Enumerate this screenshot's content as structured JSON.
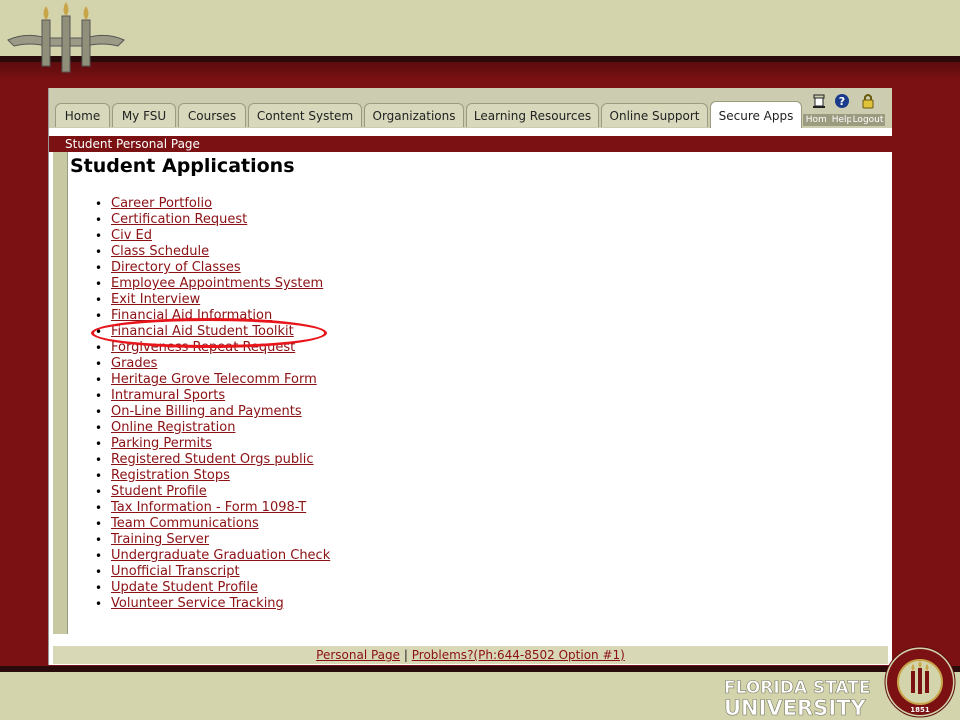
{
  "tabs": [
    {
      "label": "Home",
      "active": false
    },
    {
      "label": "My FSU",
      "active": false
    },
    {
      "label": "Courses",
      "active": false
    },
    {
      "label": "Content System",
      "active": false
    },
    {
      "label": "Organizations",
      "active": false
    },
    {
      "label": "Learning Resources",
      "active": false
    },
    {
      "label": "Online Support",
      "active": false
    },
    {
      "label": "Secure Apps",
      "active": true
    }
  ],
  "utility": {
    "home": "Home",
    "help": "Help",
    "logout": "Logout"
  },
  "subheader": "Student Personal Page",
  "page_title": "Student Applications",
  "apps": [
    "Career Portfolio",
    "Certification Request",
    "Civ Ed",
    "Class Schedule",
    "Directory of Classes",
    "Employee Appointments System",
    "Exit Interview",
    "Financial Aid Information",
    "Financial Aid Student Toolkit",
    "Forgiveness Repeat Request",
    "Grades",
    "Heritage Grove Telecomm Form",
    "Intramural Sports",
    "On-Line Billing and Payments",
    "Online Registration",
    "Parking Permits",
    "Registered Student Orgs public",
    "Registration Stops",
    "Student Profile",
    "Tax Information - Form 1098-T",
    "Team Communications",
    "Training Server",
    "Undergraduate Graduation Check",
    "Unofficial Transcript",
    "Update Student Profile",
    "Volunteer Service Tracking"
  ],
  "highlighted_app": "Financial Aid Student Toolkit",
  "footer": {
    "personal_page": "Personal Page",
    "separator": "|",
    "problems": "Problems?(Ph:644-8502 Option #1)"
  },
  "branding": {
    "wordmark_line1": "FLORIDA STATE",
    "wordmark_line2": "UNIVERSITY",
    "seal_year": "1851",
    "seal_text": "FLORIDA STATE UNIVERSITY"
  },
  "colors": {
    "garnet": "#7b1113",
    "gold": "#d4d4ac",
    "link": "#8b1114",
    "highlight": "#e8151b"
  }
}
